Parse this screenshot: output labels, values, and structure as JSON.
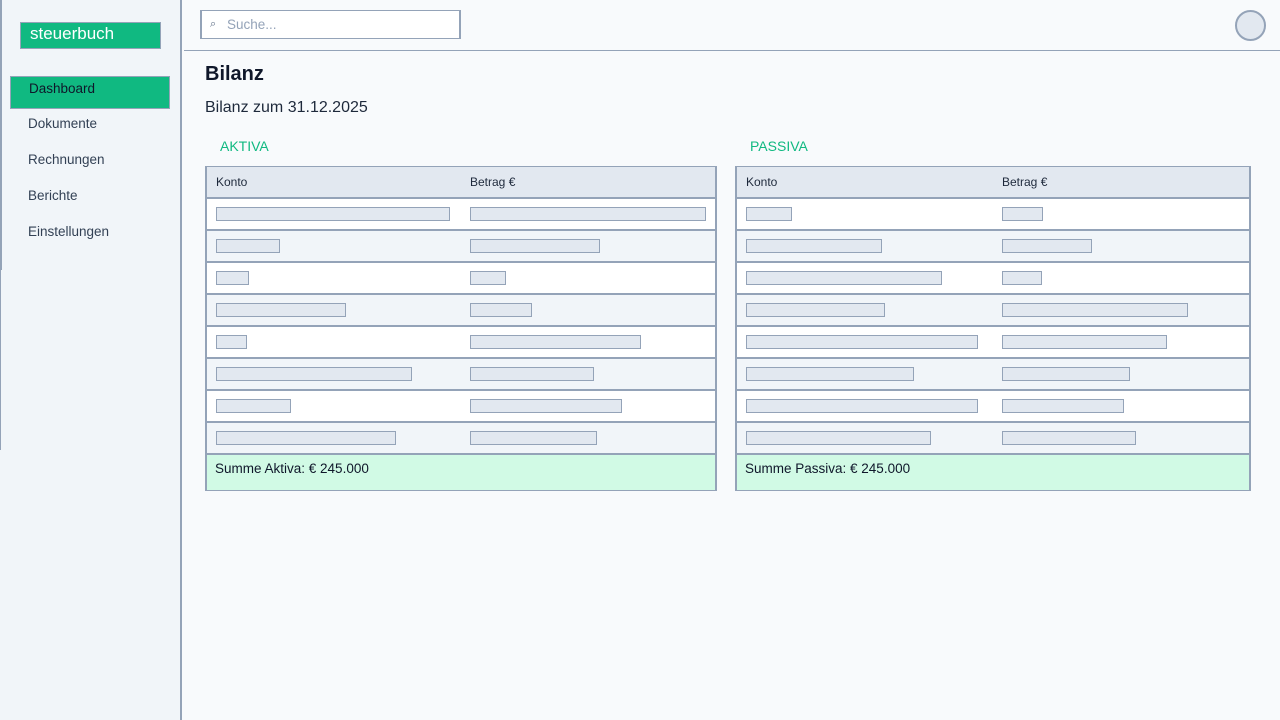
{
  "brand": "steuerbuch",
  "nav": [
    {
      "label": "Dashboard",
      "active": true
    },
    {
      "label": "Dokumente",
      "active": false
    },
    {
      "label": "Rechnungen",
      "active": false
    },
    {
      "label": "Berichte",
      "active": false
    },
    {
      "label": "Einstellungen",
      "active": false
    }
  ],
  "search": {
    "placeholder": "Suche...",
    "icon": "search-icon"
  },
  "page": {
    "title": "Bilanz",
    "subtitle": "Bilanz zum 31.12.2025"
  },
  "aktiva": {
    "title": "AKTIVA",
    "columns": [
      "Konto",
      "Betrag €"
    ],
    "sum": "Summe Aktiva: € 245.000"
  },
  "passiva": {
    "title": "PASSIVA",
    "columns": [
      "Konto",
      "Betrag €"
    ],
    "sum": "Summe Passiva: € 245.000"
  },
  "colors": {
    "accent": "#10b981",
    "border": "#94a3b8",
    "sum_bg": "#d1fae5"
  }
}
